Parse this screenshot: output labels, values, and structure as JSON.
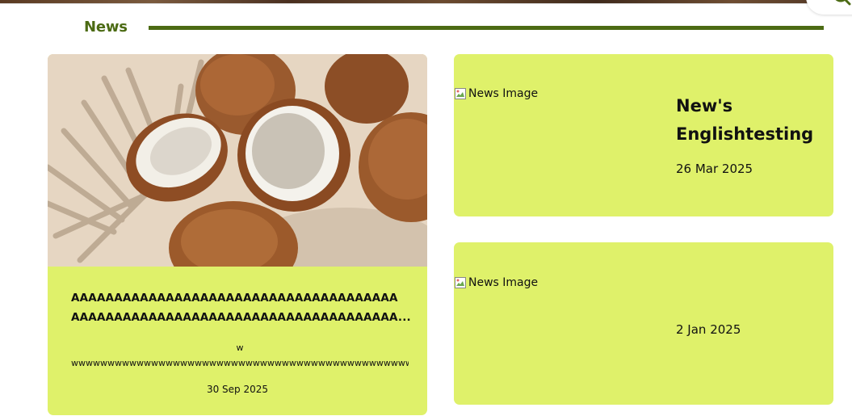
{
  "section": {
    "title": "News"
  },
  "search": {
    "icon": "search-icon"
  },
  "featured": {
    "title_lines": [
      "AAAAAAAAAAAAAAAAAAAAAAAAAAAAAAAAAAAAAA",
      "AAAAAAAAAAAAAAAAAAAAAAAAAAAAAAAAAAAAAA..."
    ],
    "excerpt_lines": [
      "w",
      "wwwwwwwwwwwwwwwwwwwwwwwwwwwwwwwwwwwwwwwwwwwwwwwww.."
    ],
    "date": "30 Sep 2025",
    "image_alt": "coconuts-photo"
  },
  "cards": [
    {
      "image_alt": "News Image",
      "title": "New's Englishtesting",
      "date": "26 Mar 2025"
    },
    {
      "image_alt": "News Image",
      "title": "",
      "date": "2 Jan 2025"
    }
  ],
  "colors": {
    "accent": "#4c6b14",
    "card_bg": "#dff16a"
  }
}
